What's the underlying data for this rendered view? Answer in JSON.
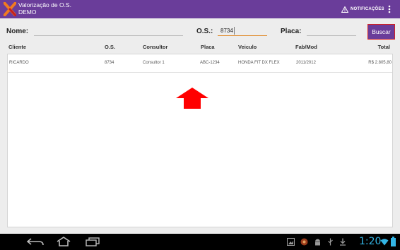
{
  "app": {
    "title": "Valorização de O.S.",
    "subtitle": "DEMO",
    "notifications_label": "NOTIFICAÇÕES",
    "accent_color": "#6a3d9a"
  },
  "search": {
    "nome_label": "Nome:",
    "nome_value": "",
    "os_label": "O.S.:",
    "os_value": "8734",
    "placa_label": "Placa:",
    "placa_value": "",
    "button_label": "Buscar"
  },
  "table": {
    "columns": [
      "Cliente",
      "O.S.",
      "Consultor",
      "Placa",
      "Veiculo",
      "Fab/Mod",
      "Total"
    ],
    "rows": [
      [
        "RICARDO",
        "8734",
        "Consultor 1",
        "ABC-1234",
        "HONDA FIT DX FLEX",
        "2011/2012",
        "R$ 2.805,80"
      ]
    ]
  },
  "annotation": {
    "icon": "up-arrow-icon",
    "color": "#ff0000"
  },
  "system_bar": {
    "time": "1:20",
    "icons": [
      "back-icon",
      "home-icon",
      "recent-apps-icon",
      "gallery-icon",
      "app-icon",
      "android-icon",
      "usb-icon",
      "download-icon",
      "wifi-icon",
      "battery-icon"
    ]
  }
}
